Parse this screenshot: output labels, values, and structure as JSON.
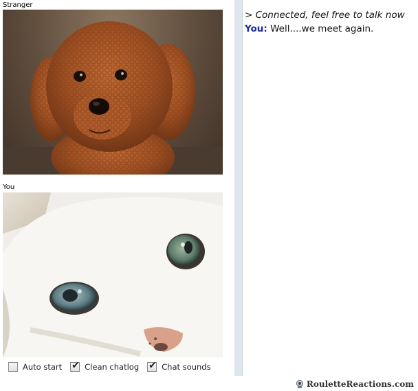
{
  "video": {
    "stranger_label": "Stranger",
    "you_label": "You"
  },
  "controls": {
    "auto_start": {
      "label": "Auto start",
      "checked": false
    },
    "clean_chatlog": {
      "label": "Clean chatlog",
      "checked": true
    },
    "chat_sounds": {
      "label": "Chat sounds",
      "checked": true
    },
    "checkmark": "✔"
  },
  "chat": {
    "status_message": "> Connected, feel free to talk now",
    "messages": [
      {
        "sender": "You:",
        "text": " Well....we meet again."
      }
    ]
  },
  "colors": {
    "sender_you": "#1a2b9c",
    "chat_divider": "#dfe6ec"
  },
  "watermark": {
    "text": "RouletteReactions.com",
    "icon": "camera-icon"
  }
}
